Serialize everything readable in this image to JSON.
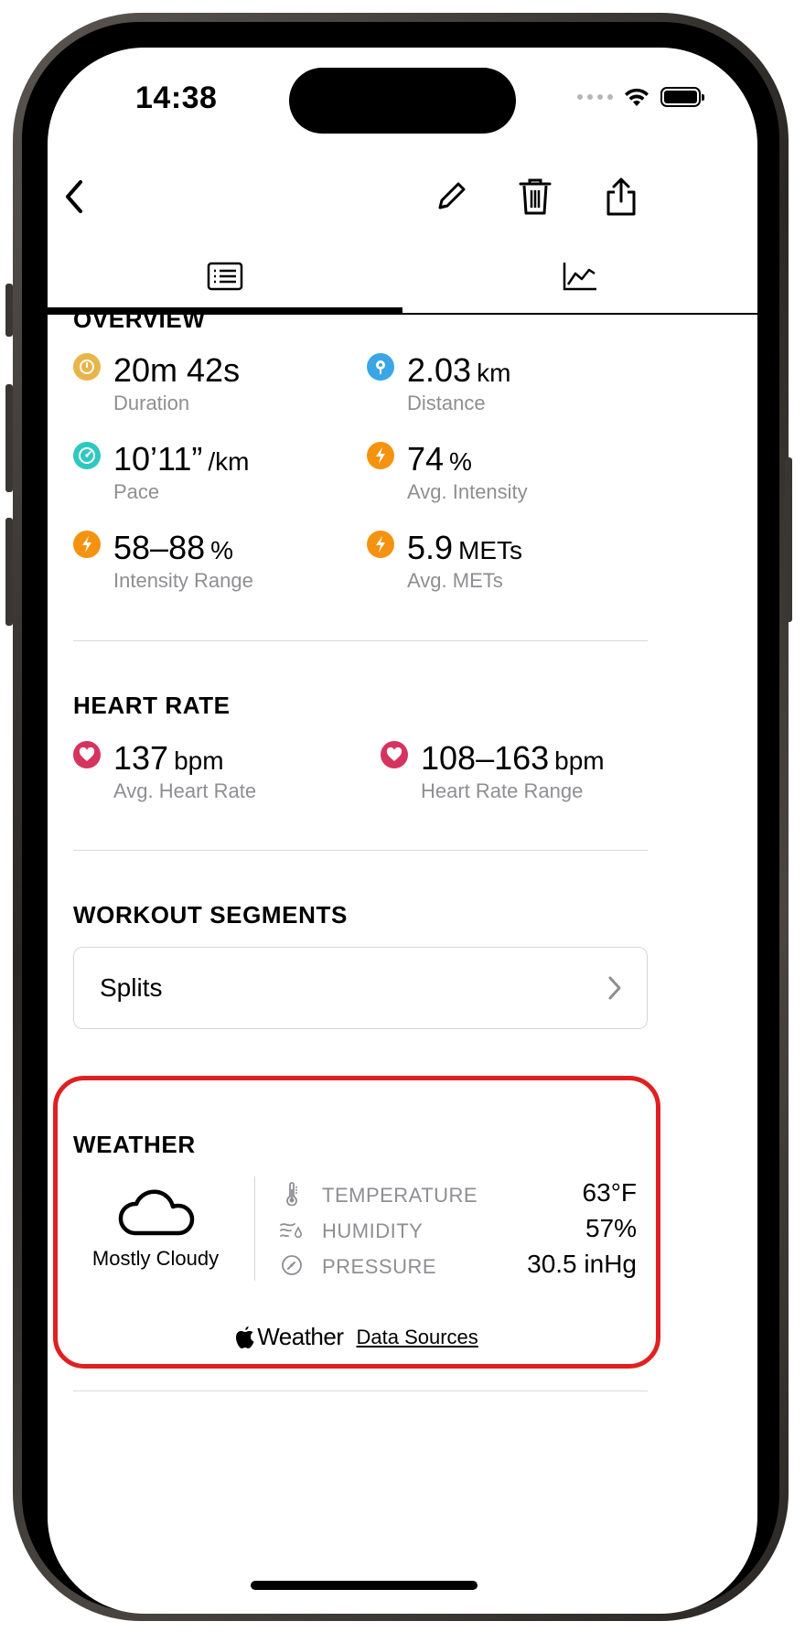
{
  "status_bar": {
    "time": "14:38"
  },
  "tabs": [
    {
      "name": "summary",
      "icon": "list-icon",
      "selected": true
    },
    {
      "name": "charts",
      "icon": "line-chart-icon",
      "selected": false
    }
  ],
  "overview": {
    "title": "OVERVIEW",
    "metrics": [
      {
        "value": "20m 42s",
        "unit": "",
        "label": "Duration",
        "icon": "timer-icon",
        "color": "#e8b54a"
      },
      {
        "value": "2.03",
        "unit": "km",
        "label": "Distance",
        "icon": "location-pin-icon",
        "color": "#3aa6e6"
      },
      {
        "value": "10’11”",
        "unit": "/km",
        "label": "Pace",
        "icon": "speedometer-icon",
        "color": "#2fc8c0"
      },
      {
        "value": "74",
        "unit": "%",
        "label": "Avg. Intensity",
        "icon": "bolt-icon",
        "color": "#f5920f"
      },
      {
        "value": "58–88",
        "unit": "%",
        "label": "Intensity Range",
        "icon": "bolt-icon",
        "color": "#f5920f"
      },
      {
        "value": "5.9",
        "unit": "METs",
        "label": "Avg. METs",
        "icon": "bolt-icon",
        "color": "#f5920f"
      }
    ]
  },
  "heart_rate": {
    "title": "HEART RATE",
    "metrics": [
      {
        "value": "137",
        "unit": "bpm",
        "label": "Avg. Heart Rate",
        "icon": "heart-icon",
        "color": "#d6335f"
      },
      {
        "value": "108–163",
        "unit": "bpm",
        "label": "Heart Rate Range",
        "icon": "heart-icon",
        "color": "#d6335f"
      }
    ]
  },
  "workout_segments": {
    "title": "WORKOUT SEGMENTS",
    "items": [
      {
        "label": "Splits"
      }
    ]
  },
  "weather": {
    "title": "WEATHER",
    "condition": "Mostly Cloudy",
    "condition_icon": "cloud-icon",
    "rows": [
      {
        "label": "TEMPERATURE",
        "value": "63°F",
        "icon": "thermometer-icon"
      },
      {
        "label": "HUMIDITY",
        "value": "57%",
        "icon": "humidity-icon"
      },
      {
        "label": "PRESSURE",
        "value": "30.5 inHg",
        "icon": "gauge-icon"
      }
    ],
    "attribution": {
      "brand": "Weather",
      "link": "Data Sources"
    },
    "highlight_color": "#e02020"
  }
}
